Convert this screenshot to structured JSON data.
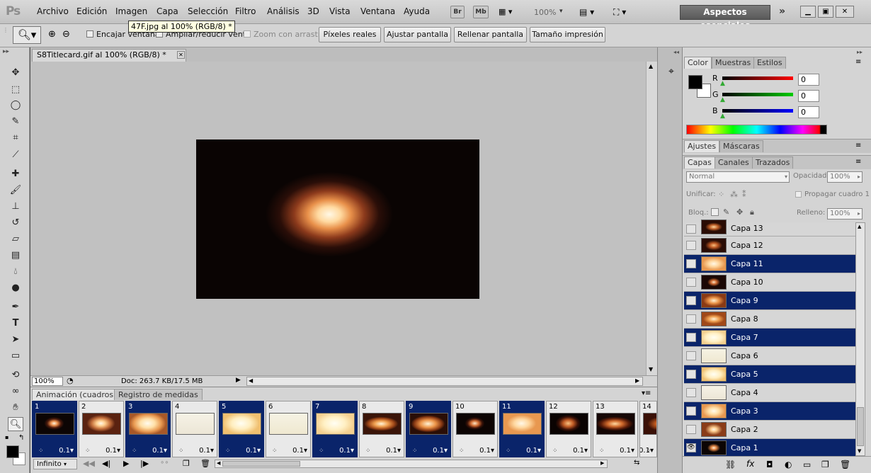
{
  "app": {
    "logo": "Ps"
  },
  "menu": [
    "Archivo",
    "Edición",
    "Imagen",
    "Capa",
    "Selección",
    "Filtro",
    "Análisis",
    "3D",
    "Vista",
    "Ventana",
    "Ayuda"
  ],
  "appbar": {
    "br": "Br",
    "mb": "Mb",
    "zoom": "100%",
    "workspace": "Aspectos esenciales"
  },
  "options": {
    "fit_window": "Encajar ventana",
    "resize_windows": "Ampliar/reducir vent.",
    "scrubby_zoom": "Zoom con arrastre",
    "actual_pixels": "Píxeles reales",
    "fit_screen": "Ajustar pantalla",
    "fill_screen": "Rellenar pantalla",
    "print_size": "Tamaño impresión"
  },
  "tooltip": "47F.jpg al 100% (RGB/8) *",
  "document": {
    "tab_title": "S8Titlecard.gif al 100% (RGB/8) *",
    "zoom": "100%",
    "doc_size": "Doc: 263.7 KB/17.5 MB"
  },
  "animation": {
    "tabs": [
      "Animación (cuadros)",
      "Registro de medidas"
    ],
    "loop": "Infinito",
    "frames": [
      {
        "n": "1",
        "delay": "0.1",
        "sel": true,
        "style": "radial-gradient(ellipse 14px 9px at 48% 48%, #fff6e0, #e88b48 35%, #4a1a0c 70%, #0c0504)"
      },
      {
        "n": "2",
        "delay": "0.1",
        "sel": false,
        "style": "radial-gradient(ellipse 20px 12px at 48% 48%, #fff8ea, #ffcf90 30%, #c4703c 65%, #5a2210)"
      },
      {
        "n": "3",
        "delay": "0.1",
        "sel": true,
        "style": "radial-gradient(ellipse 26px 16px at 48% 48%, #fffbee, #ffe0a8 40%, #e89850 75%, #a85828)"
      },
      {
        "n": "4",
        "delay": "0.1",
        "sel": false,
        "style": "linear-gradient(#f6f2e6,#ece6d6)"
      },
      {
        "n": "5",
        "delay": "0.1",
        "sel": true,
        "style": "radial-gradient(ellipse 30px 18px at 48% 48%, #fffef4, #ffeec0 45%, #f0c070 85%)"
      },
      {
        "n": "6",
        "delay": "0.1",
        "sel": false,
        "style": "linear-gradient(#f6f3e4,#efe8d0)"
      },
      {
        "n": "7",
        "delay": "0.1",
        "sel": true,
        "style": "radial-gradient(ellipse 30px 18px at 48% 48%, #fffef4, #fff0c4 50%, #f4d090 90%)"
      },
      {
        "n": "8",
        "delay": "0.1",
        "sel": false,
        "style": "radial-gradient(ellipse 24px 10px at 48% 50%, #fff4d8, #f0a050 40%, #a04818 75%, #3a1408)"
      },
      {
        "n": "9",
        "delay": "0.1",
        "sel": true,
        "style": "radial-gradient(ellipse 24px 12px at 48% 50%, #fff2d4, #ec9448 45%, #8a3a14 80%, #2a0e06)"
      },
      {
        "n": "10",
        "delay": "0.1",
        "sel": false,
        "style": "radial-gradient(ellipse 14px 9px at 48% 48%, #ffe8c8, #d06a30 40%, #3a1208 75%, #0c0403)"
      },
      {
        "n": "11",
        "delay": "0.1",
        "sel": true,
        "style": "radial-gradient(ellipse 26px 15px at 48% 48%, #fff8e8, #ffd8a0 40%, #e89850 80%)"
      },
      {
        "n": "12",
        "delay": "0.1",
        "sel": false,
        "style": "radial-gradient(ellipse 18px 12px at 48% 48%, #f8c080, #c05a24 40%, #3a1006 75%, #0a0302)"
      },
      {
        "n": "13",
        "delay": "0.1",
        "sel": false,
        "style": "radial-gradient(ellipse 26px 10px at 48% 50%, #ffd8a0, #d06a2c 40%, #5a1c08 75%, #140604)"
      },
      {
        "n": "14",
        "delay": "0.1",
        "sel": false,
        "style": "radial-gradient(ellipse 20px 10px at 48% 50%, #ffcc90, #c05a20 45%, #3a1006)"
      }
    ]
  },
  "color_panel": {
    "tabs": [
      "Color",
      "Muestras",
      "Estilos"
    ],
    "r_label": "R",
    "g_label": "G",
    "b_label": "B",
    "r": "0",
    "g": "0",
    "b": "0"
  },
  "adjust_panel": {
    "tabs": [
      "Ajustes",
      "Máscaras"
    ]
  },
  "layers_panel": {
    "tabs": [
      "Capas",
      "Canales",
      "Trazados"
    ],
    "blend_mode": "Normal",
    "opacity_label": "Opacidad:",
    "opacity": "100%",
    "unify_label": "Unificar:",
    "propagate_label": "Propagar cuadro 1",
    "lock_label": "Bloq.:",
    "fill_label": "Relleno:",
    "fill": "100%",
    "layers": [
      {
        "name": "Capa 13",
        "sel": false,
        "eye": false,
        "style": "radial-gradient(ellipse 12px 6px at 50% 50%, #ffd8a0, #c06028 50%, #2a0c04)"
      },
      {
        "name": "Capa 12",
        "sel": false,
        "eye": false,
        "style": "radial-gradient(ellipse 12px 7px at 50% 50%, #f8c080, #c05a24 45%, #2a0c04)"
      },
      {
        "name": "Capa 11",
        "sel": true,
        "eye": false,
        "style": "radial-gradient(ellipse 16px 9px at 50% 50%, #fff8e8, #ffd8a0 45%, #e89850)"
      },
      {
        "name": "Capa 10",
        "sel": false,
        "eye": false,
        "style": "radial-gradient(ellipse 9px 6px at 50% 50%, #ffe8c8, #d06a30 45%, #1a0704)"
      },
      {
        "name": "Capa 9",
        "sel": true,
        "eye": false,
        "style": "radial-gradient(ellipse 15px 8px at 50% 50%, #fff2d4, #ec9448 50%, #8a3a14)"
      },
      {
        "name": "Capa 8",
        "sel": false,
        "eye": false,
        "style": "radial-gradient(ellipse 15px 7px at 50% 50%, #fff4d8, #f0a050 50%, #a04818)"
      },
      {
        "name": "Capa 7",
        "sel": true,
        "eye": false,
        "style": "radial-gradient(ellipse 18px 10px at 50% 50%, #fffef4, #fff0c4 60%, #f4d090)"
      },
      {
        "name": "Capa 6",
        "sel": false,
        "eye": false,
        "style": "linear-gradient(#f6f3e4,#efe8d0)"
      },
      {
        "name": "Capa 5",
        "sel": true,
        "eye": false,
        "style": "radial-gradient(ellipse 18px 10px at 50% 50%, #fffef4, #ffeec0 55%, #f0c070)"
      },
      {
        "name": "Capa 4",
        "sel": false,
        "eye": false,
        "style": "linear-gradient(#f6f2e6,#ece6d6)"
      },
      {
        "name": "Capa 3",
        "sel": true,
        "eye": false,
        "style": "radial-gradient(ellipse 16px 10px at 50% 50%, #fffbee, #ffe0a8 45%, #e89850)"
      },
      {
        "name": "Capa 2",
        "sel": false,
        "eye": false,
        "style": "radial-gradient(ellipse 12px 8px at 50% 50%, #fff8ea, #ffcf90 35%, #8a3c18)"
      },
      {
        "name": "Capa 1",
        "sel": true,
        "eye": true,
        "style": "radial-gradient(ellipse 9px 6px at 50% 50%, #fff6e0, #e88b48 40%, #0c0504)"
      }
    ]
  }
}
